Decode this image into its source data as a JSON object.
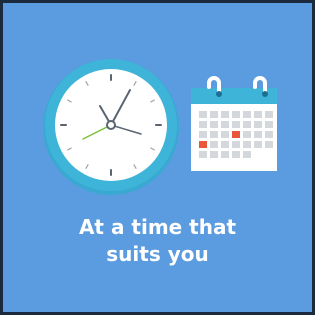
{
  "caption": {
    "line1": "At a time that",
    "line2": "suits you"
  },
  "icons": {
    "clock": "clock-icon",
    "calendar": "calendar-icon"
  },
  "colors": {
    "background": "#5b9be0",
    "border": "#1c2a3d",
    "clock_rim": "#3fb4d9",
    "clock_face": "#ffffff",
    "second_hand": "#7cc242",
    "calendar_header": "#3fb4d9",
    "calendar_cell": "#d4d8dd",
    "calendar_highlight": "#e8573c",
    "text": "#ffffff"
  }
}
